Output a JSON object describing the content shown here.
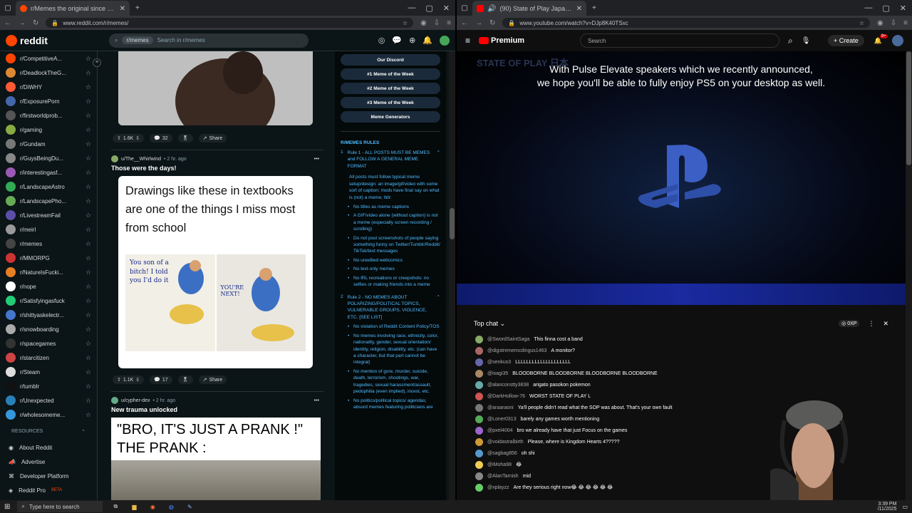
{
  "left_browser": {
    "tab_title": "r/Memes the original since 200",
    "url": "www.reddit.com/r/memes/"
  },
  "reddit": {
    "logo": "reddit",
    "search_chip": "r/memes",
    "search_placeholder": "Search in r/memes",
    "communities": [
      "r/CompetitiveA...",
      "r/DeadlockTheG...",
      "r/DiWHY",
      "r/ExposurePorn",
      "r/firstworldprob...",
      "r/gaming",
      "r/Gundam",
      "r/GuysBeingDu...",
      "r/interestingasf...",
      "r/LandscapeAstro",
      "r/LandscapePho...",
      "r/LivestreamFail",
      "r/meirl",
      "r/memes",
      "r/MMORPG",
      "r/NatureIsFucki...",
      "r/nope",
      "r/Satisfyingasfuck",
      "r/shittyaskelectr...",
      "r/snowboarding",
      "r/spacegames",
      "r/starcitizen",
      "r/Steam",
      "r/tumblr",
      "r/Unexpected",
      "r/wholesomeme..."
    ],
    "resources_label": "RESOURCES",
    "resources": [
      "About Reddit",
      "Advertise",
      "Developer Platform",
      "Reddit Pro"
    ],
    "beta": "BETA",
    "post0": {
      "votes": "1.6K",
      "comments": "32",
      "share": "Share"
    },
    "post1": {
      "user": "u/The__Whirlwind",
      "time": "• 2 hr. ago",
      "title": "Those were the days!",
      "image_text": "Drawings like these in textbooks are one of the things I miss most from school",
      "panel1_text": "You son of a bitch! I told you I'd do it",
      "panel2_text": "YOU'RE NEXT!",
      "votes": "1.1K",
      "comments": "17",
      "share": "Share"
    },
    "post2": {
      "user": "u/cypher-dex",
      "time": "• 2 hr. ago",
      "title": "New trauma unlocked",
      "image_text": "\"BRO, IT'S JUST A PRANK !\" THE PRANK :"
    },
    "side_buttons": [
      "Our Discord",
      "#1 Meme of the Week",
      "#2 Meme of the Week",
      "#3 Meme of the Week",
      "Meme Generators"
    ],
    "rules_header": "R/MEMES RULES",
    "rule1_num": "1",
    "rule1_title": "Rule 1 - ALL POSTS MUST BE MEMES and FOLLOW A GENERAL MEME FORMAT",
    "rule1_body": "All posts must follow typical meme setup/design: an image/gif/video with some sort of caption; mods have final say on what is (not) a meme; tldr:",
    "rule1_bullets": [
      "No titles as meme captions",
      "A GIF/video alone (without caption) is not a meme (especially screen recording / scrolling)",
      "Do not post screenshots of people saying something funny on Twitter/Tumblr/Reddit/ TikTok/text messages",
      "No unedited webcomics",
      "No text-only memes",
      "No IRL recreations or creepshots: no selfies or making friends into a meme"
    ],
    "rule2_num": "2",
    "rule2_title": "Rule 2 - NO MEMES ABOUT POLARIZING/POLITICAL TOPICS, VULNERABLE GROUPS, VIOLENCE, ETC. [SEE LIST]",
    "rule2_bullets": [
      "No violation of Reddit Content Policy/TOS",
      "No memes involving race, ethnicity, color, nationality, gender, sexual orientation/ identity, religion, disability, etc. (can have a character, but that part cannot be integral)",
      "No mention of gore, murder, suicide, death, terrorism, shootings, war, tragedies, sexual harassment/assault, pedophilia (even implied), incest, etc.",
      "No politics/political topics/ agendas; absurd memes featuring politicians are"
    ]
  },
  "right_browser": {
    "tab_title": "(90) State of Play Japan | N",
    "url": "www.youtube.com/watch?v=DJp8K40TSxc"
  },
  "youtube": {
    "logo": "Premium",
    "search_placeholder": "Search",
    "create": "Create",
    "notif_badge": "9+",
    "caption_line1": "With Pulse Elevate speakers which we recently announced,",
    "caption_line2": "we hope you'll be able to fully enjoy PS5 on your desktop as well.",
    "watermark": "STATE OF PLAY 日本",
    "chat_mode": "Top chat",
    "points": "0XP",
    "chat": [
      {
        "u": "@SwordSaintSaga",
        "m": "This finna cost a band"
      },
      {
        "u": "@digstrememcdingus1463",
        "m": "A monitor?"
      },
      {
        "u": "@senkus3",
        "m": "LLLLLLLLLLLLLLLLLLLL"
      },
      {
        "u": "@isagi35",
        "m": "BLOODBORNE BLOODBORNE BLOODBORNE BLOODBORNE"
      },
      {
        "u": "@alanconstty3838",
        "m": "arigato pasokon pokemon"
      },
      {
        "u": "@DarkHollow-76",
        "m": "WORST STATE OF PLAY L"
      },
      {
        "u": "@araaraoni",
        "m": "Ya'll people didn't read what the SOP was about. That's your own fault"
      },
      {
        "u": "@Loner0313",
        "m": "barely any games worth mentioning"
      },
      {
        "u": "@pxel4004",
        "m": "bro we already have that just Focus on the games"
      },
      {
        "u": "@voidastralbirth",
        "m": "Please, where is Kingdom Hearts 4?????"
      },
      {
        "u": "@sagbag856",
        "m": "oh shi"
      },
      {
        "u": "@iMoha98",
        "m": "😂"
      },
      {
        "u": "@AlanTarnish",
        "m": "mid"
      },
      {
        "u": "@xplayzz",
        "m": "Are they serious right now😂 😂 😂 😂 😂 😂"
      }
    ]
  },
  "taskbar": {
    "search": "Type here to search",
    "time": "3:39 PM",
    "date": "/11/2025"
  }
}
